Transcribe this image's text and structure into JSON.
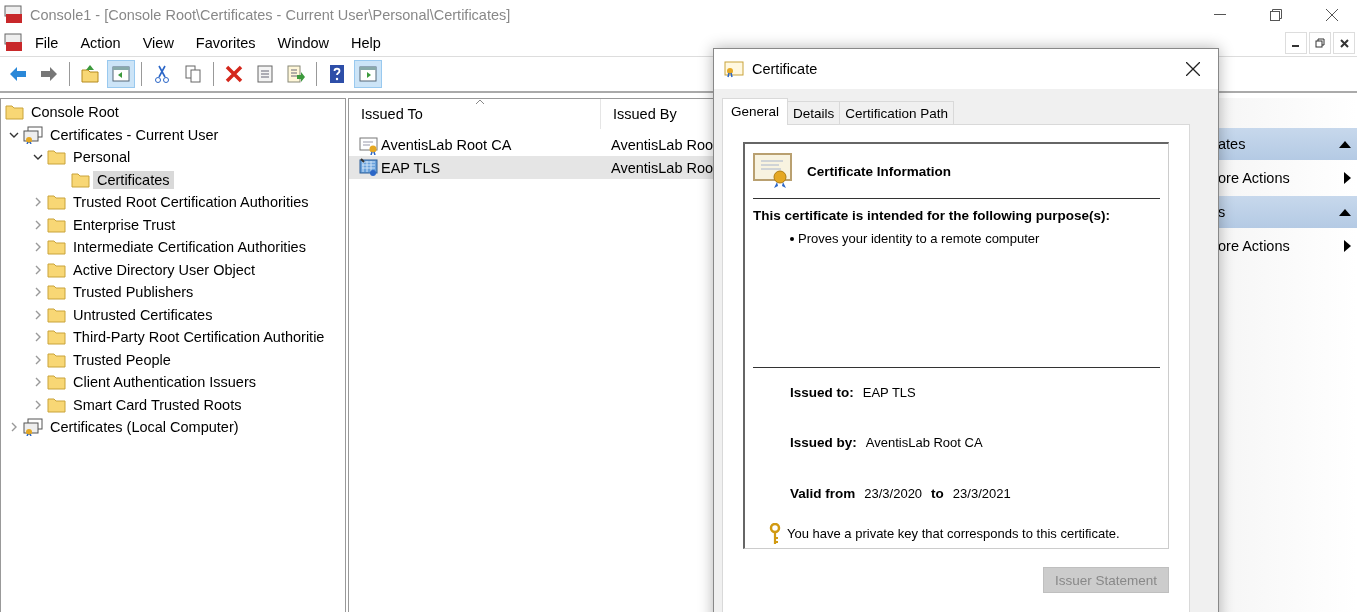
{
  "window": {
    "title": "Console1 - [Console Root\\Certificates - Current User\\Personal\\Certificates]"
  },
  "menu": [
    "File",
    "Action",
    "View",
    "Favorites",
    "Window",
    "Help"
  ],
  "toolbar": [
    {
      "kind": "back",
      "pressed": false
    },
    {
      "kind": "forward",
      "pressed": false
    },
    {
      "kind": "separator"
    },
    {
      "kind": "up",
      "pressed": false
    },
    {
      "kind": "tree",
      "pressed": true
    },
    {
      "kind": "separator"
    },
    {
      "kind": "cut",
      "pressed": false
    },
    {
      "kind": "copy",
      "pressed": false
    },
    {
      "kind": "separator"
    },
    {
      "kind": "delete",
      "pressed": false
    },
    {
      "kind": "properties",
      "pressed": false
    },
    {
      "kind": "export",
      "pressed": false
    },
    {
      "kind": "separator"
    },
    {
      "kind": "help",
      "pressed": false
    },
    {
      "kind": "actionpane",
      "pressed": true
    }
  ],
  "tree": [
    {
      "label": "Console Root",
      "kind": "folder",
      "selected": false,
      "children": [
        {
          "label": "Certificates - Current User",
          "kind": "store",
          "expanded": true,
          "selected": false,
          "children": [
            {
              "label": "Personal",
              "kind": "folder",
              "expanded": true,
              "selected": false,
              "children": [
                {
                  "label": "Certificates",
                  "kind": "folder",
                  "selected": true
                }
              ]
            },
            {
              "label": "Trusted Root Certification Authorities",
              "kind": "folder",
              "expanded": false,
              "selected": false
            },
            {
              "label": "Enterprise Trust",
              "kind": "folder",
              "expanded": false,
              "selected": false
            },
            {
              "label": "Intermediate Certification Authorities",
              "kind": "folder",
              "expanded": false,
              "selected": false
            },
            {
              "label": "Active Directory User Object",
              "kind": "folder",
              "expanded": false,
              "selected": false
            },
            {
              "label": "Trusted Publishers",
              "kind": "folder",
              "expanded": false,
              "selected": false
            },
            {
              "label": "Untrusted Certificates",
              "kind": "folder",
              "expanded": false,
              "selected": false
            },
            {
              "label": "Third-Party Root Certification Authoritie",
              "kind": "folder",
              "expanded": false,
              "selected": false
            },
            {
              "label": "Trusted People",
              "kind": "folder",
              "expanded": false,
              "selected": false
            },
            {
              "label": "Client Authentication Issuers",
              "kind": "folder",
              "expanded": false,
              "selected": false
            },
            {
              "label": "Smart Card Trusted Roots",
              "kind": "folder",
              "expanded": false,
              "selected": false
            }
          ]
        },
        {
          "label": "Certificates (Local Computer)",
          "kind": "store",
          "expanded": false,
          "selected": false
        }
      ]
    }
  ],
  "list": {
    "columns": [
      {
        "label": "Issued To",
        "sorted": true
      },
      {
        "label": "Issued By",
        "sorted": false
      }
    ],
    "rows": [
      {
        "issued_to": "AventisLab Root CA",
        "issued_by": "AventisLab Roo",
        "kind": "cert",
        "selected": false
      },
      {
        "issued_to": "EAP TLS",
        "issued_by": "AventisLab Roo",
        "kind": "keycert",
        "selected": true
      }
    ]
  },
  "actions": [
    {
      "header": "ates",
      "items": [
        "ore Actions"
      ]
    },
    {
      "header": "s",
      "items": [
        "ore Actions"
      ]
    }
  ],
  "dialog": {
    "title": "Certificate",
    "tabs": [
      {
        "label": "General",
        "selected": true
      },
      {
        "label": "Details",
        "selected": false
      },
      {
        "label": "Certification Path",
        "selected": false
      }
    ],
    "info_title": "Certificate Information",
    "purpose_heading": "This certificate is intended for the following purpose(s):",
    "purposes": [
      "Proves your identity to a remote computer"
    ],
    "issued_to_label": "Issued to:",
    "issued_to": "EAP TLS",
    "issued_by_label": "Issued by:",
    "issued_by": "AventisLab Root CA",
    "valid_from_label": "Valid from",
    "valid_from": "23/3/2020",
    "to_label": "to",
    "valid_to": "23/3/2021",
    "key_note": "You have a private key that corresponds to this certificate.",
    "button": {
      "label": "Issuer Statement",
      "disabled": true
    }
  }
}
